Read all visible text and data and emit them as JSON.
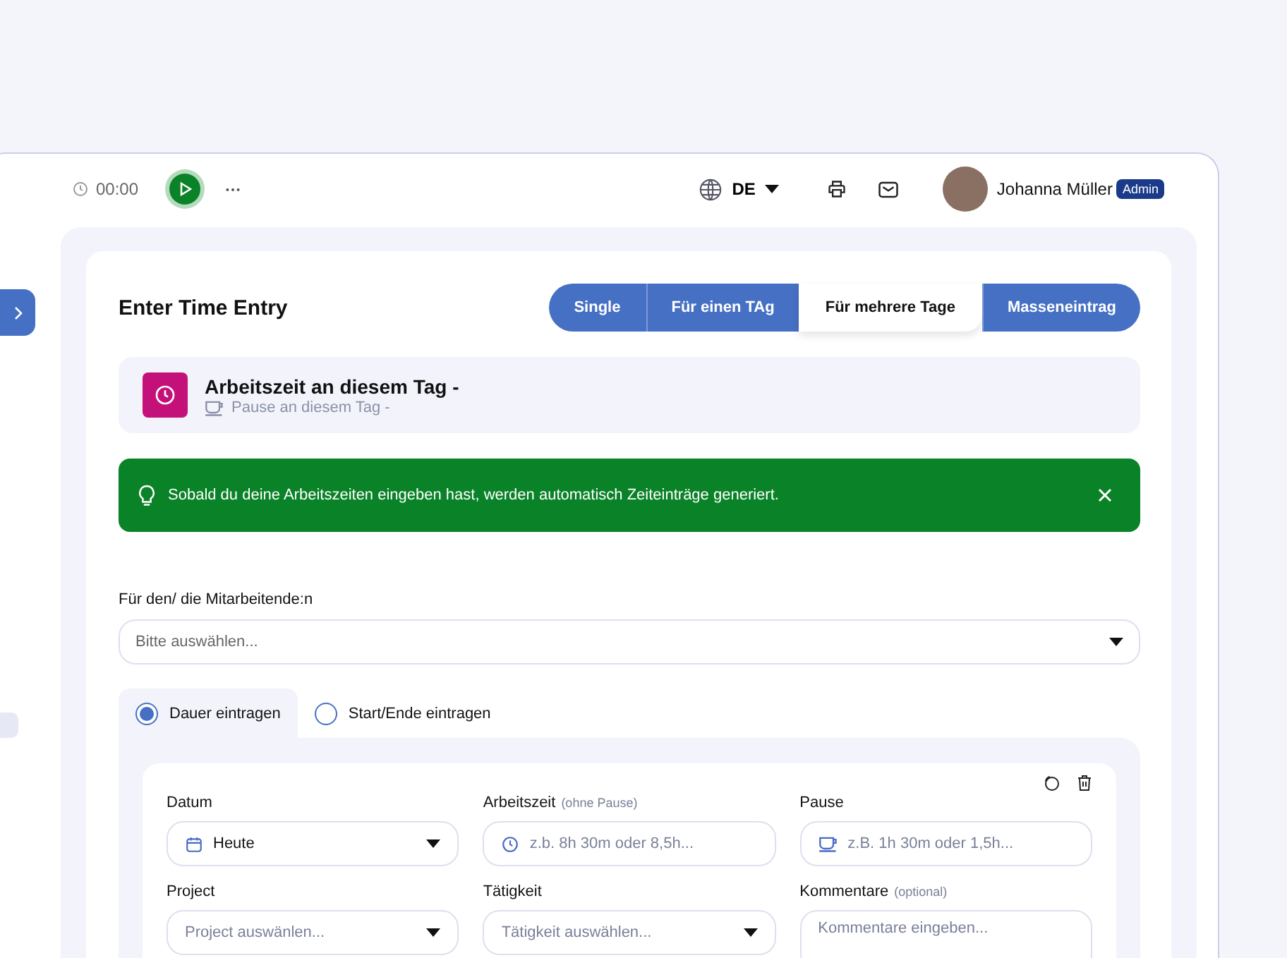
{
  "topbar": {
    "timer": "00:00",
    "running": false,
    "language": "DE",
    "user": {
      "name": "Johanna Müller",
      "role": "Admin"
    }
  },
  "title": "Enter Time Entry",
  "tabs": [
    {
      "label": "Single",
      "selected": false
    },
    {
      "label": "Für einen TAg",
      "selected": false
    },
    {
      "label": "Für mehrere Tage",
      "selected": true
    },
    {
      "label": "Masseneintrag",
      "selected": false
    }
  ],
  "summary": {
    "work": "Arbeitszeit an diesem Tag -",
    "break": "Pause an diesem Tag -"
  },
  "alert": {
    "text": "Sobald du deine Arbeitszeiten eingeben hast, werden automatisch Zeiteinträge generiert.",
    "dismissible": true
  },
  "employee": {
    "label": "Für den/ die Mitarbeitende:n",
    "placeholder": "Bitte auswählen..."
  },
  "modes": [
    {
      "label": "Dauer eintragen",
      "selected": true
    },
    {
      "label": "Start/Ende eintragen",
      "selected": false
    }
  ],
  "fields": [
    {
      "kind": "date",
      "label": "Datum",
      "value": "Heute"
    },
    {
      "kind": "duration",
      "label": "Arbeitszeit",
      "hint": "(ohne Pause)",
      "placeholder": "z.b. 8h 30m oder 8,5h..."
    },
    {
      "kind": "break",
      "label": "Pause",
      "placeholder": "z.B. 1h 30m oder 1,5h..."
    },
    {
      "kind": "select",
      "label": "Project",
      "placeholder": "Project auswänlen..."
    },
    {
      "kind": "select",
      "label": "Tätigkeit",
      "placeholder": "Tätigkeit auswählen..."
    },
    {
      "kind": "textarea",
      "label": "Kommentare",
      "hint": "(optional)",
      "placeholder": "Kommentare eingeben..."
    }
  ]
}
